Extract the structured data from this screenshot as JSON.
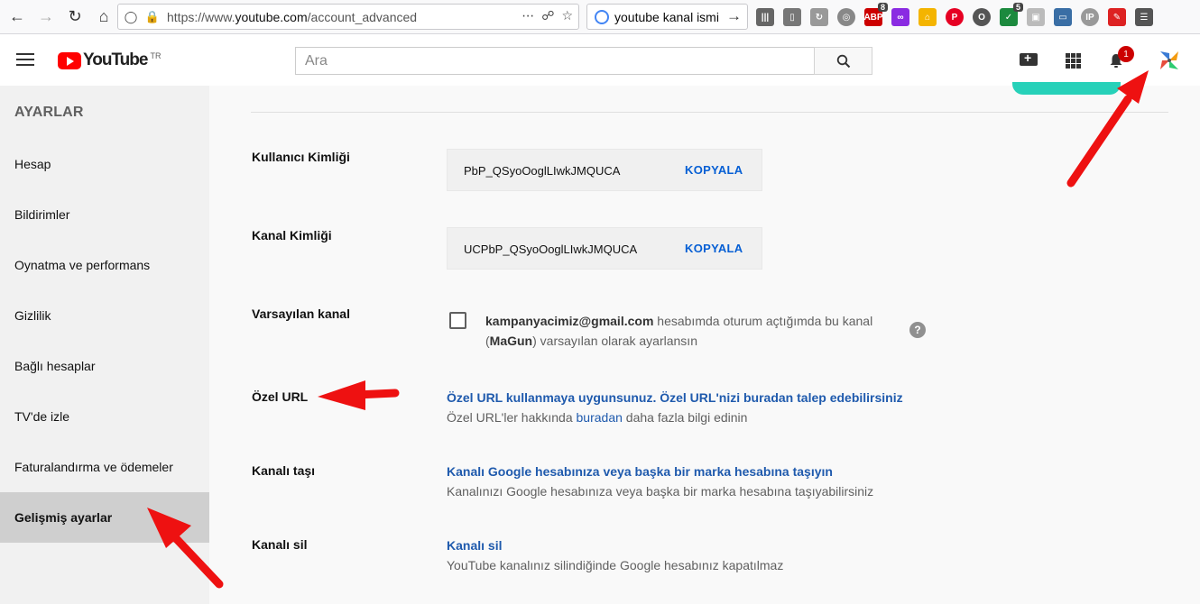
{
  "browser": {
    "url_prefix": "https://www.",
    "url_domain": "youtube.com",
    "url_path": "/account_advanced",
    "search_text": "youtube kanal ismi",
    "ext_badge_abp": "8",
    "ext_badge_shield": "5",
    "ext_label_abp": "ABP",
    "ext_label_ip": "IP"
  },
  "header": {
    "logo_text": "YouTube",
    "logo_region": "TR",
    "search_placeholder": "Ara",
    "notification_count": "1"
  },
  "sidebar": {
    "heading": "AYARLAR",
    "items": [
      {
        "label": "Hesap"
      },
      {
        "label": "Bildirimler"
      },
      {
        "label": "Oynatma ve performans"
      },
      {
        "label": "Gizlilik"
      },
      {
        "label": "Bağlı hesaplar"
      },
      {
        "label": "TV'de izle"
      },
      {
        "label": "Faturalandırma ve ödemeler"
      },
      {
        "label": "Gelişmiş ayarlar"
      }
    ]
  },
  "main": {
    "user_id": {
      "label": "Kullanıcı Kimliği",
      "value": "PbP_QSyoOoglLIwkJMQUCA",
      "copy": "KOPYALA"
    },
    "channel_id": {
      "label": "Kanal Kimliği",
      "value": "UCPbP_QSyoOoglLIwkJMQUCA",
      "copy": "KOPYALA"
    },
    "default_channel": {
      "label": "Varsayılan kanal",
      "email": "kampanyacimiz@gmail.com",
      "text1": " hesabımda oturum açtığımda bu kanal",
      "paren_open": "(",
      "channel_name": "MaGun",
      "text2": ") varsayılan olarak ayarlansın",
      "help": "?"
    },
    "custom_url": {
      "label": "Özel URL",
      "link": "Özel URL kullanmaya uygunsunuz. Özel URL'nizi buradan talep edebilirsiniz",
      "desc_pre": "Özel URL'ler hakkında ",
      "desc_link": "buradan",
      "desc_post": " daha fazla bilgi edinin"
    },
    "move_channel": {
      "label": "Kanalı taşı",
      "link": "Kanalı Google hesabınıza veya başka bir marka hesabına taşıyın",
      "desc": "Kanalınızı Google hesabınıza veya başka bir marka hesabına taşıyabilirsiniz"
    },
    "delete_channel": {
      "label": "Kanalı sil",
      "link": "Kanalı sil",
      "desc": "YouTube kanalınız silindiğinde Google hesabınız kapatılmaz"
    }
  },
  "colors": {
    "annotation_arrow": "#ee1111",
    "link": "#1f5aad",
    "yt_red": "#ff0000"
  }
}
